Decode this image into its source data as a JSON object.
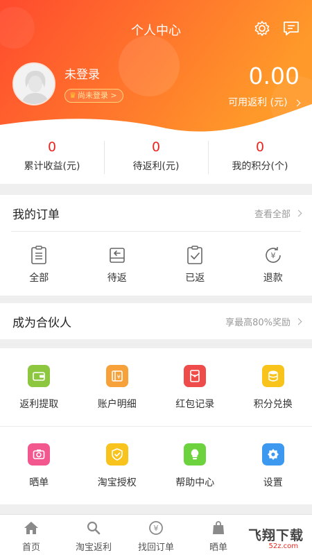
{
  "header": {
    "title": "个人中心",
    "icons": [
      "gear-icon",
      "message-icon"
    ],
    "gradient": [
      "#ff4a2e",
      "#ff9a2a"
    ]
  },
  "user": {
    "name": "未登录",
    "login_badge": "尚未登录 >",
    "balance": "0.00",
    "balance_label": "可用返利 (元)"
  },
  "stats": [
    {
      "value": "0",
      "label": "累计收益(元)"
    },
    {
      "value": "0",
      "label": "待返利(元)"
    },
    {
      "value": "0",
      "label": "我的积分(个)"
    }
  ],
  "orders": {
    "title": "我的订单",
    "more": "查看全部",
    "items": [
      {
        "label": "全部",
        "icon": "clipboard-list-icon"
      },
      {
        "label": "待返",
        "icon": "return-box-icon"
      },
      {
        "label": "已返",
        "icon": "clipboard-check-icon"
      },
      {
        "label": "退款",
        "icon": "yen-refund-icon"
      }
    ]
  },
  "partner": {
    "title": "成为合伙人",
    "more": "享最高80%奖励"
  },
  "tools": [
    {
      "label": "返利提取",
      "icon": "wallet-icon",
      "color": "#8dc63f"
    },
    {
      "label": "账户明细",
      "icon": "ledger-icon",
      "color": "#f7a13b"
    },
    {
      "label": "红包记录",
      "icon": "red-envelope-icon",
      "color": "#ee4b4b"
    },
    {
      "label": "积分兑换",
      "icon": "coins-icon",
      "color": "#f8c41b"
    },
    {
      "label": "晒单",
      "icon": "camera-icon",
      "color": "#f2588e"
    },
    {
      "label": "淘宝授权",
      "icon": "shield-check-icon",
      "color": "#f9c31e"
    },
    {
      "label": "帮助中心",
      "icon": "lightbulb-icon",
      "color": "#6cd23e"
    },
    {
      "label": "设置",
      "icon": "settings-icon",
      "color": "#3d99f0"
    }
  ],
  "tabbar": [
    {
      "label": "首页",
      "icon": "home-icon"
    },
    {
      "label": "淘宝返利",
      "icon": "search-icon"
    },
    {
      "label": "找回订单",
      "icon": "yen-circle-icon"
    },
    {
      "label": "晒单",
      "icon": "bag-icon"
    }
  ],
  "watermark": {
    "text": "飞翔下载",
    "sub": "52z.com"
  }
}
